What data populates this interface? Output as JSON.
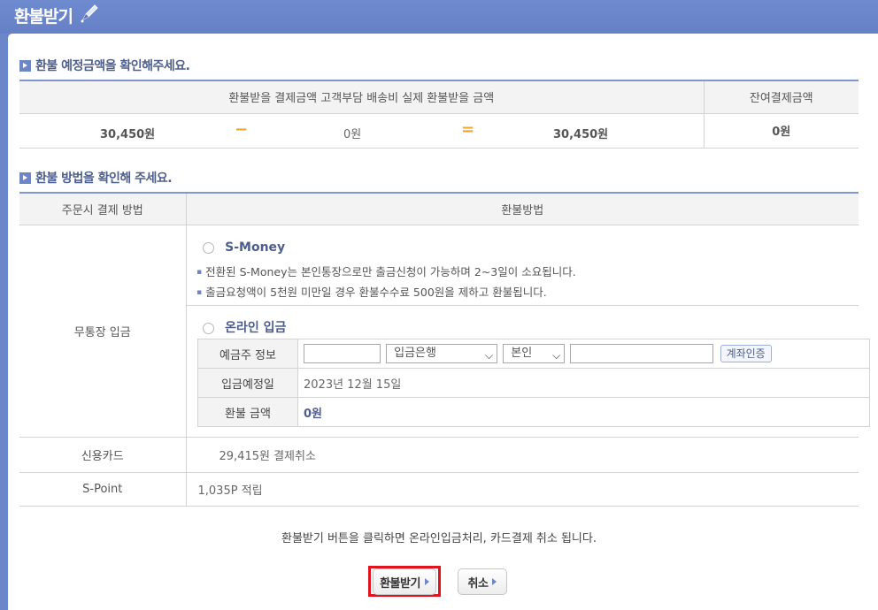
{
  "header": {
    "title": "환불받기",
    "icon": "pencil-icon"
  },
  "section1": {
    "title": "환불 예정금액을 확인해주세요.",
    "header_main": "환불받을 결제금액 고객부담 배송비 실제 환불받을 금액",
    "header_right": "잔여결제금액",
    "payment_amount": "30,450원",
    "minus": "−",
    "shipping_fee": "0원",
    "equals": "=",
    "refund_amount": "30,450원",
    "remaining_amount": "0원"
  },
  "section2": {
    "title": "환불 방법을 확인해 주세요.",
    "col_left": "주문시 결제 방법",
    "col_right": "환불방법",
    "bank_transfer_label": "무통장 입금",
    "smoney": {
      "label": "S-Money",
      "notes": [
        "전환된 S-Money는 본인통장으로만 출금신청이 가능하며 2~3일이 소요됩니다.",
        "출금요청액이 5천원 미만일 경우 환불수수료 500원을 제하고 환불됩니다."
      ]
    },
    "online": {
      "label": "온라인 입금",
      "depositor_label": "예금주 정보",
      "depositor_value": "",
      "bank_select": "입금은행",
      "owner_select": "본인",
      "account_value": "",
      "verify_button": "계좌인증",
      "deposit_date_label": "입금예정일",
      "deposit_date": "2023년 12월 15일",
      "refund_amount_label": "환불 금액",
      "refund_amount": "0원"
    },
    "credit_card_label": "신용카드",
    "credit_card_value": "29,415원 결제취소",
    "spoint_label": "S-Point",
    "spoint_value": "1,035P 적립"
  },
  "footer": {
    "note": "환불받기 버튼을 클릭하면 온라인입금처리, 카드결제 취소 됩니다.",
    "refund_button": "환불받기",
    "cancel_button": "취소"
  },
  "colors": {
    "accent": "#6f86c6",
    "highlight": "#e0141e",
    "operator": "#f6a32a"
  }
}
